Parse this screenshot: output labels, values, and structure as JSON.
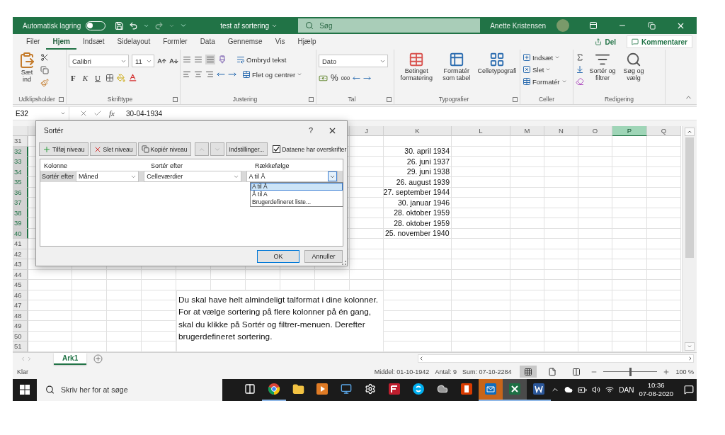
{
  "title_bar": {
    "autosave_label": "Automatisk lagring",
    "autosave_on": false,
    "document_title": "test af sortering",
    "search_placeholder": "Søg",
    "user_name": "Anette Kristensen"
  },
  "ribbon_tabs": [
    {
      "label": "Filer",
      "selected": false
    },
    {
      "label": "Hjem",
      "selected": true
    },
    {
      "label": "Indsæt",
      "selected": false
    },
    {
      "label": "Sidelayout",
      "selected": false
    },
    {
      "label": "Formler",
      "selected": false
    },
    {
      "label": "Data",
      "selected": false
    },
    {
      "label": "Gennemse",
      "selected": false
    },
    {
      "label": "Vis",
      "selected": false
    },
    {
      "label": "Hjælp",
      "selected": false
    }
  ],
  "share_button": "Del",
  "comments_button": "Kommentarer",
  "clipboard": {
    "paste_label": "Sæt ind",
    "group_label": "Udklipsholder"
  },
  "font": {
    "font_name": "Calibri",
    "font_size": "11",
    "bold": "F",
    "italic": "K",
    "underline": "U",
    "group_label": "Skrifttype"
  },
  "alignment": {
    "wrap_text": "Ombryd tekst",
    "merge_center": "Flet og centrer",
    "group_label": "Justering"
  },
  "number": {
    "format": "Dato",
    "percent": "%",
    "thousands": "000",
    "group_label": "Tal"
  },
  "styles": {
    "conditional": "Betinget formatering",
    "format_table": "Formatér som tabel",
    "cell_styles": "Celletypografi",
    "group_label": "Typografier"
  },
  "cells": {
    "insert": "Indsæt",
    "delete": "Slet",
    "format": "Formatér",
    "group_label": "Celler"
  },
  "editing": {
    "sort_filter": "Sortér og filtrer",
    "find_select": "Søg og vælg",
    "group_label": "Redigering"
  },
  "formula_bar": {
    "name_box": "E32",
    "function_label": "fx",
    "value": "30-04-1934"
  },
  "columns": [
    {
      "label": "J",
      "selected": false
    },
    {
      "label": "K",
      "selected": false
    },
    {
      "label": "L",
      "selected": false
    },
    {
      "label": "M",
      "selected": false
    },
    {
      "label": "N",
      "selected": false
    },
    {
      "label": "O",
      "selected": false
    },
    {
      "label": "P",
      "selected": true
    },
    {
      "label": "Q",
      "selected": false
    }
  ],
  "rows": [
    {
      "number": "31",
      "selected": false
    },
    {
      "number": "32",
      "selected": true,
      "k_value": "30. april 1934",
      "kind": "date"
    },
    {
      "number": "33",
      "selected": true,
      "k_value": "26. juni 1937",
      "kind": "date"
    },
    {
      "number": "34",
      "selected": true,
      "k_value": "29. juni 1938",
      "kind": "date"
    },
    {
      "number": "35",
      "selected": true,
      "k_value": "26. august 1939",
      "kind": "date"
    },
    {
      "number": "36",
      "selected": true,
      "k_value": "27. september 1944",
      "kind": "date"
    },
    {
      "number": "37",
      "selected": true,
      "k_value": "30. januar 1946",
      "kind": "date"
    },
    {
      "number": "38",
      "selected": true,
      "k_value": "28. oktober 1959",
      "kind": "date"
    },
    {
      "number": "39",
      "selected": true,
      "k_value": "28. oktober 1959",
      "kind": "date"
    },
    {
      "number": "40",
      "selected": true,
      "k_value": "25. november 1940",
      "kind": "text"
    },
    {
      "number": "41",
      "selected": false
    },
    {
      "number": "42",
      "selected": false
    },
    {
      "number": "43",
      "selected": false
    },
    {
      "number": "44",
      "selected": false
    },
    {
      "number": "45",
      "selected": false
    },
    {
      "number": "46",
      "selected": false
    },
    {
      "number": "47",
      "selected": false
    },
    {
      "number": "48",
      "selected": false
    },
    {
      "number": "49",
      "selected": false
    },
    {
      "number": "50",
      "selected": false
    },
    {
      "number": "51",
      "selected": false
    }
  ],
  "text_box": "Du skal have helt almindeligt talformat i dine kolonner. For at vælge sortering på flere kolonner på én gang, skal du klikke på Sortér og filtrer-menuen. Derefter brugerdefineret sortering.",
  "dialog": {
    "title": "Sortér",
    "help": "?",
    "toolbar": [
      {
        "label": "Tilføj niveau",
        "kind": "add"
      },
      {
        "label": "Slet niveau",
        "kind": "delete"
      },
      {
        "label": "Kopiér niveau",
        "kind": "copy"
      }
    ],
    "move_buttons_disabled": true,
    "options_button": "Indstillinger...",
    "headers_checkbox": {
      "label": "Dataene har overskrifter",
      "checked": true
    },
    "list_headers": [
      "Kolonne",
      "Sortér efter",
      "Rækkefølge"
    ],
    "levels": [
      {
        "label": "Sortér efter",
        "column": "Måned",
        "sort_on": "Celleværdier",
        "order": "A til Å",
        "selected": true
      }
    ],
    "order_options": [
      {
        "label": "A til Å",
        "selected": true
      },
      {
        "label": "Å til A",
        "selected": false
      },
      {
        "label": "Brugerdefineret liste...",
        "selected": false
      }
    ],
    "ok_button": "OK",
    "cancel_button": "Annuller"
  },
  "sheet_tabs": [
    {
      "label": "Ark1",
      "selected": true
    }
  ],
  "status_bar": {
    "ready": "Klar",
    "average": "Middel: 01-10-1942",
    "count": "Antal: 9",
    "sum": "Sum: 07-10-2284",
    "views": [
      {
        "kind": "normal",
        "selected": true
      },
      {
        "kind": "page_layout",
        "selected": false
      },
      {
        "kind": "page_break",
        "selected": false
      }
    ],
    "zoom_slider": {
      "level": 0.5
    },
    "zoom": "100 %"
  },
  "taskbar": {
    "search_placeholder": "Skriv her for at søge",
    "apps": [
      {
        "kind": "task_view",
        "running": false,
        "selected": false,
        "attention": false
      },
      {
        "kind": "browser",
        "running": true,
        "selected": false,
        "attention": false
      },
      {
        "kind": "folder",
        "running": false,
        "selected": false,
        "attention": false
      },
      {
        "kind": "media",
        "running": false,
        "selected": false,
        "attention": false
      },
      {
        "kind": "monitor",
        "running": false,
        "selected": false,
        "attention": false
      },
      {
        "kind": "settings",
        "running": false,
        "selected": false,
        "attention": false
      },
      {
        "kind": "ftp",
        "running": false,
        "selected": false,
        "attention": false
      },
      {
        "kind": "chat",
        "running": false,
        "selected": false,
        "attention": false
      },
      {
        "kind": "cloud_app",
        "running": false,
        "selected": false,
        "attention": false
      },
      {
        "kind": "office",
        "running": false,
        "selected": false,
        "attention": false
      },
      {
        "kind": "mail",
        "running": true,
        "selected": false,
        "attention": true
      },
      {
        "kind": "spreadsheet",
        "running": true,
        "selected": true,
        "attention": false
      },
      {
        "kind": "document",
        "running": true,
        "selected": false,
        "attention": false
      }
    ],
    "language": "DAN",
    "time": "10:36",
    "date": "07-08-2020"
  }
}
